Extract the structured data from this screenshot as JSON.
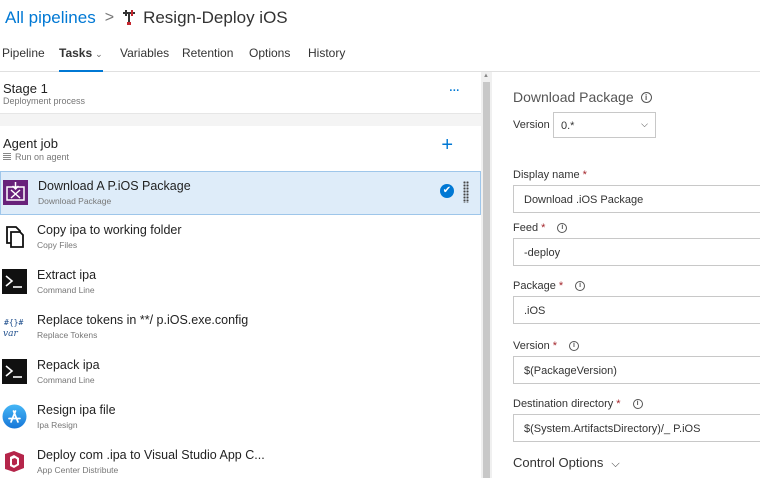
{
  "breadcrumb": {
    "root": "All pipelines",
    "separator": ">",
    "pipeline": "Resign-Deploy iOS"
  },
  "tabs": [
    {
      "label": "Pipeline"
    },
    {
      "label": "Tasks"
    },
    {
      "label": "Variables"
    },
    {
      "label": "Retention"
    },
    {
      "label": "Options"
    },
    {
      "label": "History"
    }
  ],
  "stage": {
    "title": "Stage 1",
    "subtitle": "Deployment process",
    "more": "..."
  },
  "agent_job": {
    "title": "Agent job",
    "subtitle": "Run on agent",
    "add": "+"
  },
  "tasks": [
    {
      "title": "Download A   P.iOS Package",
      "subtitle": "Download Package",
      "icon": "download-package-icon",
      "selected": true
    },
    {
      "title": "Copy ipa to working folder",
      "subtitle": "Copy Files",
      "icon": "copy-files-icon"
    },
    {
      "title": "Extract ipa",
      "subtitle": "Command Line",
      "icon": "command-line-icon"
    },
    {
      "title": "Replace tokens in **/              p.iOS.exe.config",
      "subtitle": "Replace Tokens",
      "icon": "replace-tokens-icon"
    },
    {
      "title": "Repack ipa",
      "subtitle": "Command Line",
      "icon": "command-line-icon"
    },
    {
      "title": "Resign ipa file",
      "subtitle": "Ipa Resign",
      "icon": "app-store-icon"
    },
    {
      "title": "Deploy com                    .ipa to Visual Studio App C...",
      "subtitle": "App Center Distribute",
      "icon": "app-center-icon"
    }
  ],
  "detail": {
    "title": "Download Package",
    "version_label": "Version",
    "version_value": "0.*",
    "display_name_label": "Display name",
    "display_name_value": "Download          .iOS Package",
    "feed_label": "Feed",
    "feed_value": "       -deploy",
    "package_label": "Package",
    "package_value": "       .iOS",
    "pkg_version_label": "Version",
    "pkg_version_value": "$(PackageVersion)",
    "dest_label": "Destination directory",
    "dest_value": "$(System.ArtifactsDirectory)/_     P.iOS",
    "control_options": "Control Options",
    "required_mark": "*",
    "info_glyph": "i",
    "check_glyph": "✔",
    "dropdown_glyph": "⌵"
  },
  "colors": {
    "accent": "#0078d4",
    "selected_row": "#deecf9",
    "required": "#a4262c"
  }
}
